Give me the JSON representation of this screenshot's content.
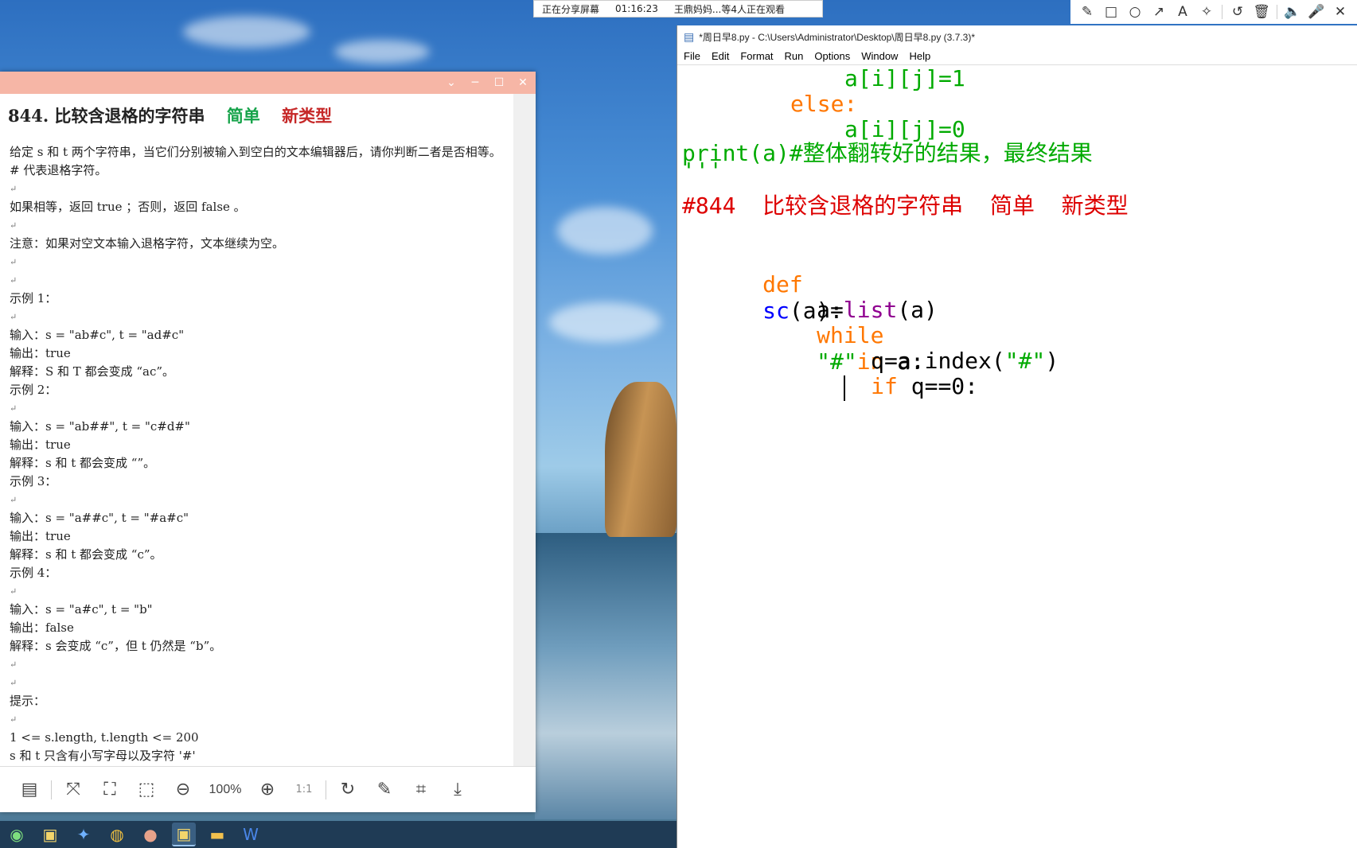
{
  "share_bar": {
    "status": "正在分享屏幕",
    "time": "01:16:23",
    "viewers": "王鼎妈妈...等4人正在观看"
  },
  "annotation_toolbar": {
    "icons": [
      "pen-icon",
      "rectangle-icon",
      "circle-icon",
      "arrow-icon",
      "text-icon",
      "magic-wand-icon",
      "undo-icon",
      "trash-icon",
      "speaker-icon",
      "microphone-icon",
      "close-icon"
    ]
  },
  "viewer": {
    "title_number": "844.",
    "title_text": "比较含退格的字符串",
    "tag_easy": "简单",
    "tag_new": "新类型",
    "lines": [
      "给定 s 和 t 两个字符串，当它们分别被输入到空白的文本编辑器后，请你判断二者是否相等。# 代表退格字符。",
      "如果相等，返回 true ；否则，返回 false 。",
      "注意：如果对空文本输入退格字符，文本继续为空。",
      "示例 1：",
      "输入：s = \"ab#c\", t = \"ad#c\"",
      "输出：true",
      "解释：S 和 T 都会变成 “ac”。",
      "示例 2：",
      "输入：s = \"ab##\", t = \"c#d#\"",
      "输出：true",
      "解释：s 和 t 都会变成 “”。",
      "示例 3：",
      "输入：s = \"a##c\", t = \"#a#c\"",
      "输出：true",
      "解释：s 和 t 都会变成 “c”。",
      "示例 4：",
      "输入：s = \"a#c\", t = \"b\"",
      "输出：false",
      "解释：s 会变成 “c”，但 t 仍然是 “b”。",
      "提示：",
      "1 <= s.length, t.length <= 200",
      "s 和 t 只含有小写字母以及字符 '#'"
    ],
    "return_mark": "↵",
    "zoom": "100%",
    "one_to_one": "1:1"
  },
  "idle": {
    "window_title": "*周日早8.py - C:\\Users\\Administrator\\Desktop\\周日早8.py (3.7.3)*",
    "menu": [
      "File",
      "Edit",
      "Format",
      "Run",
      "Options",
      "Window",
      "Help"
    ],
    "code": {
      "l1": "a[i][j]=1",
      "l2_kw": "else:",
      "l3": "a[i][j]=0",
      "l4": "print(a)#整体翻转好的结果，最终结果",
      "l5": "'''",
      "l6": "#844  比较含退格的字符串  简单  新类型",
      "l7_kw": "def",
      "l7_fn": "sc",
      "l7_rest": "(a):",
      "l8_a": "a=",
      "l8_bi": "list",
      "l8_b": "(a)",
      "l9_kw": "while",
      "l9_str": "\"#\"",
      "l9_kw2": "in",
      "l9_rest": " a:",
      "l10_a": "q=a.index(",
      "l10_str": "\"#\"",
      "l10_b": ")",
      "l11_kw": "if",
      "l11_rest": " q==0:"
    }
  }
}
